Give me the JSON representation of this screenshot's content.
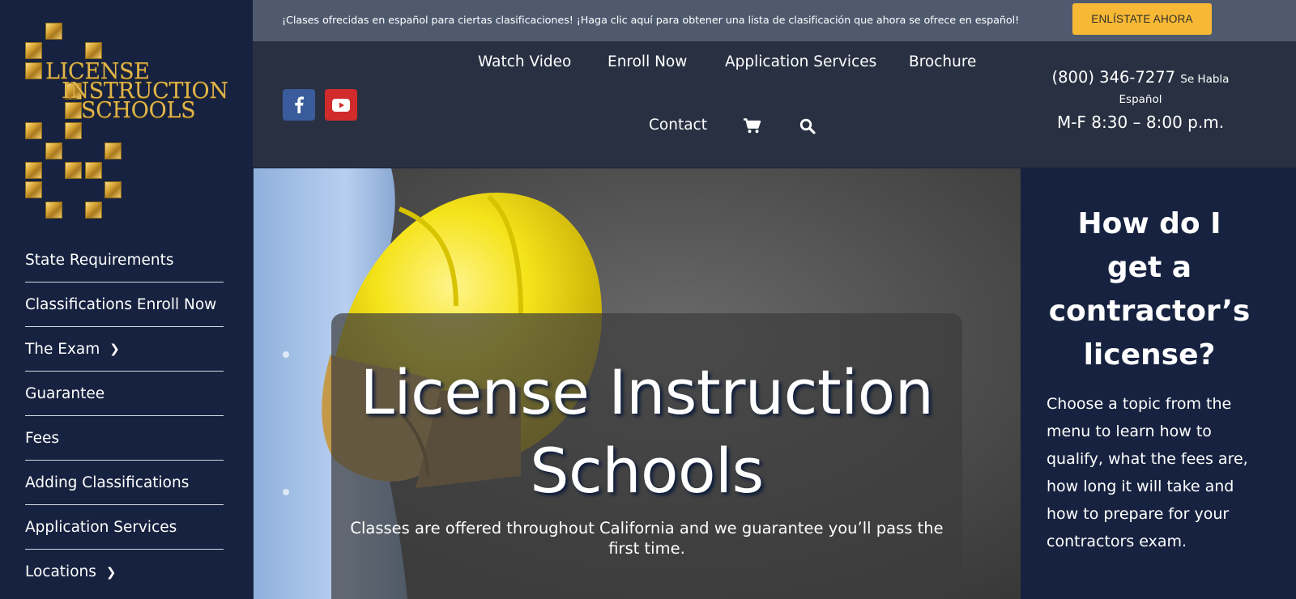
{
  "brand": {
    "logo_lines": [
      "LICENSE",
      "INSTRUCTION",
      "SCHOOLS"
    ]
  },
  "sidebar": {
    "items": [
      {
        "label": "State Requirements",
        "has_submenu": false
      },
      {
        "label": "Classifications Enroll Now",
        "has_submenu": false
      },
      {
        "label": "The Exam",
        "has_submenu": true
      },
      {
        "label": "Guarantee",
        "has_submenu": false
      },
      {
        "label": "Fees",
        "has_submenu": false
      },
      {
        "label": "Adding Classifications",
        "has_submenu": false
      },
      {
        "label": "Application Services",
        "has_submenu": false
      },
      {
        "label": "Locations",
        "has_submenu": true
      }
    ]
  },
  "banner": {
    "text": "¡Clases ofrecidas en español para ciertas clasificaciones! ¡Haga clic aquí para obtener una lista de clasificación que ahora se ofrece en español!",
    "button_label": "ENLÍSTATE AHORA",
    "bg_color": "#4f5a6f",
    "button_color": "#f7b935"
  },
  "header": {
    "nav": [
      {
        "label": "Watch Video"
      },
      {
        "label": "Enroll Now"
      },
      {
        "label": "Application Services"
      },
      {
        "label": "Brochure"
      },
      {
        "label": "Contact"
      }
    ],
    "icons": {
      "cart": "cart-icon",
      "search": "search-icon",
      "facebook": "facebook-icon",
      "youtube": "youtube-icon"
    },
    "phone": "(800) 346-7277",
    "phone_note": "Se Habla",
    "phone_note_2": "Español",
    "hours": "M-F 8:30 – 8:00 p.m."
  },
  "hero": {
    "title_line_1": "License Instruction",
    "title_line_2": "Schools",
    "subtitle": "Classes are offered throughout California and we guarantee you’ll pass the first time."
  },
  "right_panel": {
    "heading_lines": [
      "How do I",
      "get a",
      "contractor’s",
      "license?"
    ],
    "body": "Choose a topic from the menu to learn how to qualify, what the fees are, how long it will take and how to prepare for your contractors exam."
  },
  "colors": {
    "sidebar_bg": "#16223f",
    "header_bg": "#283042",
    "accent_gold": "#e0b54b"
  }
}
